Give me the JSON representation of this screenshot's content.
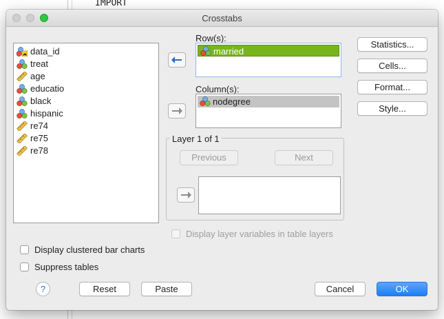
{
  "background": {
    "code_text": "IMPORT"
  },
  "window": {
    "title": "Crosstabs"
  },
  "variables": [
    {
      "name": "data_id",
      "icon": "nominal-string-icon"
    },
    {
      "name": "treat",
      "icon": "nominal-icon"
    },
    {
      "name": "age",
      "icon": "scale-ruler-icon"
    },
    {
      "name": "educatio",
      "icon": "nominal-icon"
    },
    {
      "name": "black",
      "icon": "nominal-icon"
    },
    {
      "name": "hispanic",
      "icon": "nominal-icon"
    },
    {
      "name": "re74",
      "icon": "scale-ruler-icon"
    },
    {
      "name": "re75",
      "icon": "scale-ruler-icon"
    },
    {
      "name": "re78",
      "icon": "scale-ruler-icon"
    }
  ],
  "rows": {
    "label": "Row(s):",
    "items": [
      "married"
    ]
  },
  "columns": {
    "label": "Column(s):",
    "items": [
      "nodegree"
    ]
  },
  "layer": {
    "title": "Layer 1 of 1",
    "previous_label": "Previous",
    "next_label": "Next"
  },
  "options": {
    "display_layer_vars": "Display layer variables in table layers",
    "clustered_bar": "Display clustered bar charts",
    "suppress_tables": "Suppress tables"
  },
  "side_buttons": {
    "statistics": "Statistics...",
    "cells": "Cells...",
    "format": "Format...",
    "style": "Style..."
  },
  "footer": {
    "help": "?",
    "reset": "Reset",
    "paste": "Paste",
    "cancel": "Cancel",
    "ok": "OK"
  },
  "colors": {
    "row_selected": "#78b51d",
    "ok_button": "#1c7ef4",
    "column_selected": "#c4c4c4"
  }
}
